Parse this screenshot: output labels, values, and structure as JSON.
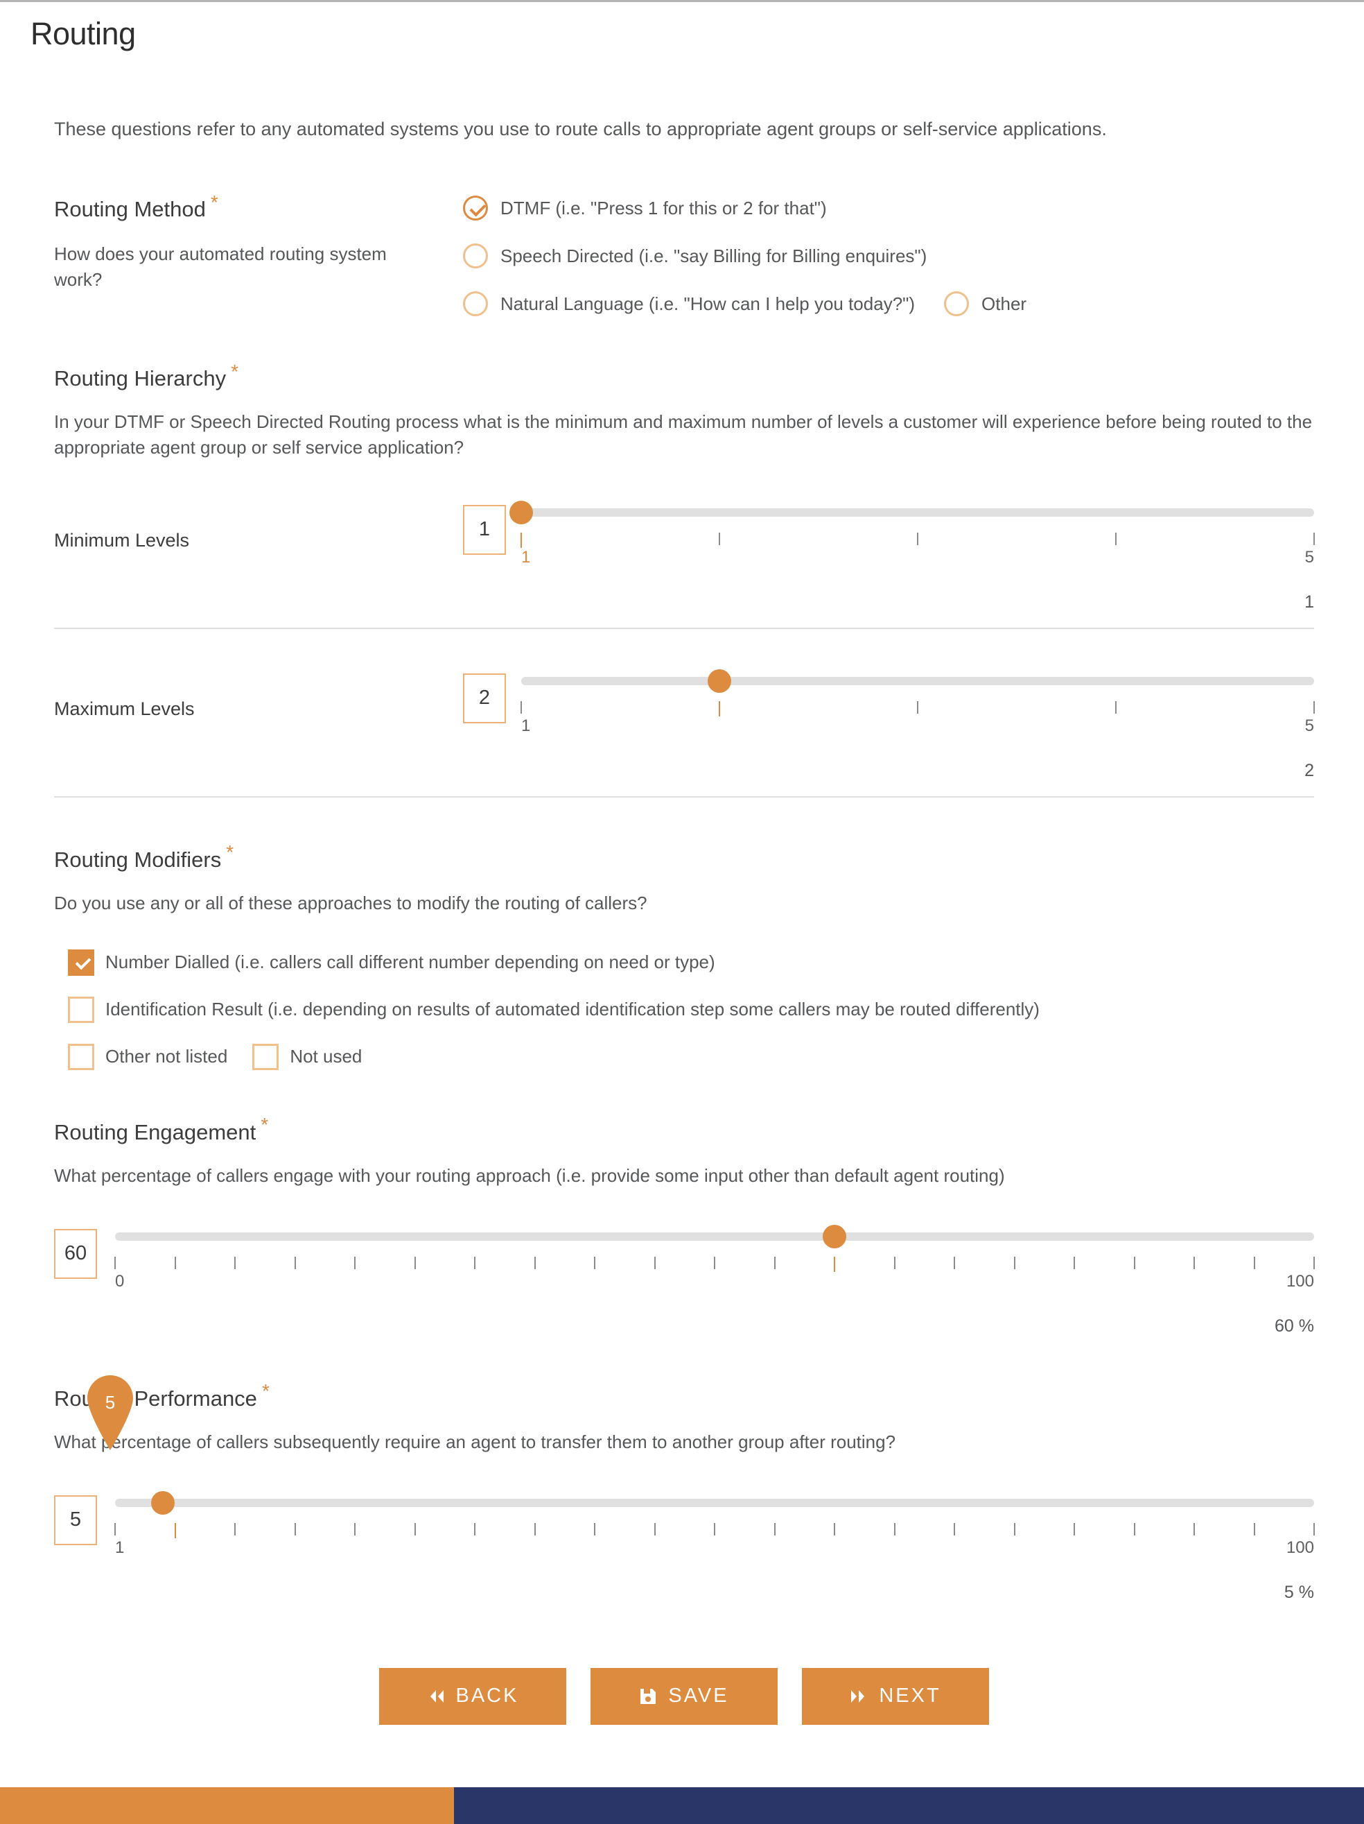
{
  "page": {
    "title": "Routing",
    "intro": "These questions refer to any automated systems you use to route calls to appropriate agent groups or self-service applications.",
    "required_marker": "*"
  },
  "theme": {
    "accent": "#dd8b3f",
    "accent_light": "#f0c08d",
    "navy": "#2b3668",
    "track": "#e0e0e0",
    "text": "#555759",
    "heading": "#3c3c3c"
  },
  "routing_method": {
    "heading": "Routing Method",
    "sub": "How does your automated routing system work?",
    "options": [
      {
        "label": "DTMF (i.e. \"Press 1 for this or 2 for that\")",
        "selected": true
      },
      {
        "label": "Speech Directed (i.e. \"say Billing for Billing enquires\")",
        "selected": false
      },
      {
        "label": "Natural Language (i.e. \"How can I help you today?\")",
        "selected": false
      },
      {
        "label": "Other",
        "selected": false
      }
    ]
  },
  "routing_hierarchy": {
    "heading": "Routing Hierarchy",
    "sub": "In your DTMF or Speech Directed Routing process what is the minimum and maximum number of levels a customer will experience before being routed to the appropriate agent group or self service application?",
    "sliders": [
      {
        "label": "Minimum Levels",
        "value": "1",
        "min_label": "1",
        "max_label": "5",
        "min": 1,
        "max": 5,
        "ticks": 5,
        "readout": "1"
      },
      {
        "label": "Maximum Levels",
        "value": "2",
        "min_label": "1",
        "max_label": "5",
        "min": 1,
        "max": 5,
        "ticks": 5,
        "readout": "2"
      }
    ]
  },
  "routing_modifiers": {
    "heading": "Routing Modifiers",
    "sub": "Do you use any or all of these approaches to modify the routing of callers?",
    "options": [
      {
        "label": "Number Dialled (i.e. callers call different number depending on need or type)",
        "checked": true
      },
      {
        "label": "Identification Result (i.e. depending on results of automated identification step some callers may be routed differently)",
        "checked": false
      },
      {
        "label": "Other not listed",
        "checked": false
      },
      {
        "label": "Not used",
        "checked": false
      }
    ]
  },
  "routing_engagement": {
    "heading": "Routing Engagement",
    "sub": "What percentage of callers engage with your routing approach (i.e. provide some input other than default agent routing)",
    "slider": {
      "value": "60",
      "min_label": "0",
      "max_label": "100",
      "min": 0,
      "max": 100,
      "ticks": 21,
      "readout": "60 %"
    }
  },
  "routing_performance": {
    "heading": "Routing Performance",
    "sub": "What percentage of callers subsequently require an agent to transfer them to another group after routing?",
    "slider": {
      "value": "5",
      "min_label": "1",
      "max_label": "100",
      "min": 1,
      "max": 100,
      "ticks": 21,
      "readout": "5 %"
    },
    "pin_value": "5"
  },
  "buttons": {
    "back": "BACK",
    "save": "SAVE",
    "next": "NEXT"
  }
}
